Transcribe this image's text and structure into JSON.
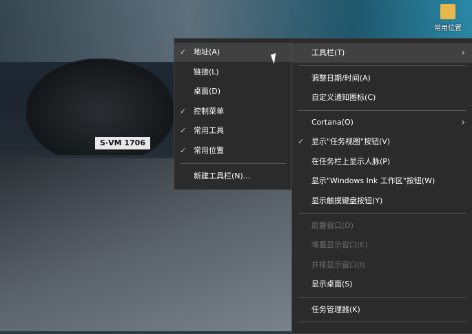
{
  "desktop": {
    "plate": "S·VM 1706",
    "icon_label": "常用位置"
  },
  "submenu": {
    "items": [
      {
        "label": "地址(A)",
        "checked": true,
        "highlighted": true
      },
      {
        "label": "链接(L)",
        "checked": false
      },
      {
        "label": "桌面(D)",
        "checked": false
      },
      {
        "label": "控制菜单",
        "checked": true
      },
      {
        "label": "常用工具",
        "checked": true
      },
      {
        "label": "常用位置",
        "checked": true
      }
    ],
    "new_toolbar": "新建工具栏(N)..."
  },
  "menu": {
    "items": [
      {
        "label": "工具栏(T)",
        "submenu": true
      },
      {
        "label": "调整日期/时间(A)"
      },
      {
        "label": "自定义通知图标(C)"
      },
      {
        "label": "Cortana(O)",
        "submenu": true
      },
      {
        "label": "显示\"任务视图\"按钮(V)",
        "checked": true
      },
      {
        "label": "在任务栏上显示人脉(P)"
      },
      {
        "label": "显示\"Windows Ink 工作区\"按钮(W)"
      },
      {
        "label": "显示触摸键盘按钮(Y)"
      },
      {
        "label": "层叠窗口(D)",
        "disabled": true
      },
      {
        "label": "堆叠显示窗口(E)",
        "disabled": true
      },
      {
        "label": "并排显示窗口(I)",
        "disabled": true
      },
      {
        "label": "显示桌面(S)"
      },
      {
        "label": "任务管理器(K)"
      }
    ]
  },
  "glyphs": {
    "check": "✓",
    "arrow": "›"
  }
}
